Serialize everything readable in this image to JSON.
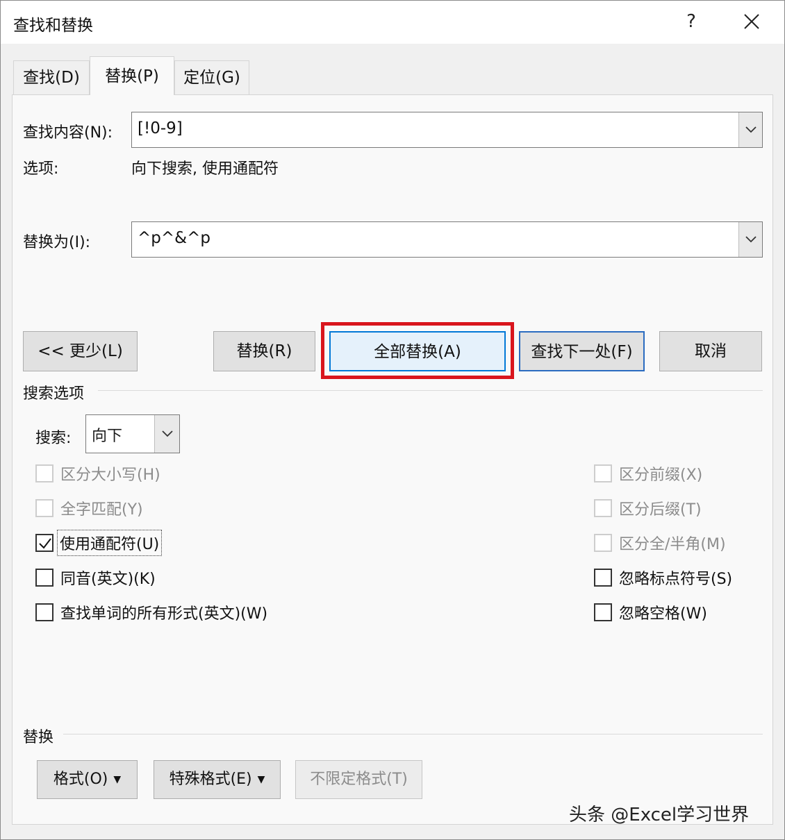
{
  "window": {
    "title": "查找和替换",
    "help": "?",
    "close_icon": "close-icon"
  },
  "tabs": [
    {
      "label": "查找(D)",
      "active": false
    },
    {
      "label": "替换(P)",
      "active": true
    },
    {
      "label": "定位(G)",
      "active": false
    }
  ],
  "find": {
    "label": "查找内容(N):",
    "value": "[!0-9]"
  },
  "options": {
    "label": "选项:",
    "value": "向下搜索, 使用通配符"
  },
  "replace": {
    "label": "替换为(I):",
    "value": "^p^&^p"
  },
  "buttons": {
    "less": "<< 更少(L)",
    "replace": "替换(R)",
    "replace_all": "全部替换(A)",
    "find_next": "查找下一处(F)",
    "cancel": "取消"
  },
  "search_options": {
    "section_title": "搜索选项",
    "search_label": "搜索:",
    "search_value": "向下",
    "left_checks": [
      {
        "label": "区分大小写(H)",
        "checked": false,
        "disabled": true
      },
      {
        "label": "全字匹配(Y)",
        "checked": false,
        "disabled": true
      },
      {
        "label": "使用通配符(U)",
        "checked": true,
        "disabled": false
      },
      {
        "label": "同音(英文)(K)",
        "checked": false,
        "disabled": false
      },
      {
        "label": "查找单词的所有形式(英文)(W)",
        "checked": false,
        "disabled": false
      }
    ],
    "right_checks": [
      {
        "label": "区分前缀(X)",
        "checked": false,
        "disabled": true
      },
      {
        "label": "区分后缀(T)",
        "checked": false,
        "disabled": true
      },
      {
        "label": "区分全/半角(M)",
        "checked": false,
        "disabled": true
      },
      {
        "label": "忽略标点符号(S)",
        "checked": false,
        "disabled": false
      },
      {
        "label": "忽略空格(W)",
        "checked": false,
        "disabled": false
      }
    ]
  },
  "replace_section": {
    "title": "替换",
    "format": "格式(O)",
    "special": "特殊格式(E)",
    "no_format": "不限定格式(T)"
  },
  "watermark": "头条 @Excel学习世界",
  "colors": {
    "highlight": "#d9151d",
    "primary_border": "#0078d7"
  }
}
